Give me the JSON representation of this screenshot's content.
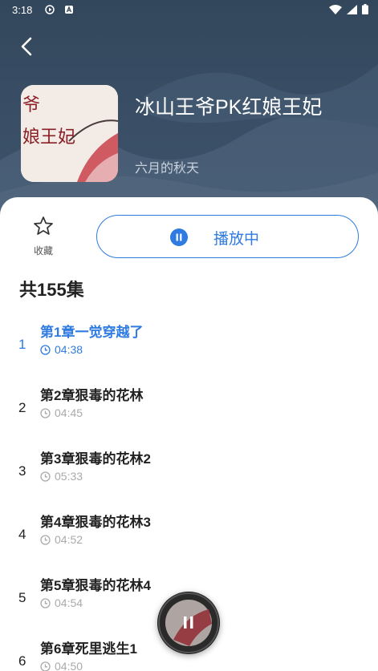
{
  "status": {
    "time": "3:18"
  },
  "book": {
    "title": "冰山王爷PK红娘王妃",
    "author": "六月的秋天",
    "cover_text": "爷 娘王妃"
  },
  "actions": {
    "favorite_label": "收藏",
    "play_label": "播放中"
  },
  "total": "共155集",
  "episodes": [
    {
      "num": "1",
      "title": "第1章一觉穿越了",
      "duration": "04:38",
      "active": true
    },
    {
      "num": "2",
      "title": "第2章狠毒的花林",
      "duration": "04:45"
    },
    {
      "num": "3",
      "title": "第3章狠毒的花林2",
      "duration": "05:33"
    },
    {
      "num": "4",
      "title": "第4章狠毒的花林3",
      "duration": "04:52"
    },
    {
      "num": "5",
      "title": "第5章狠毒的花林4",
      "duration": "04:54"
    },
    {
      "num": "6",
      "title": "第6章死里逃生1",
      "duration": "04:50"
    }
  ],
  "colors": {
    "accent": "#2f7be0",
    "header_bg": "#34495f"
  }
}
